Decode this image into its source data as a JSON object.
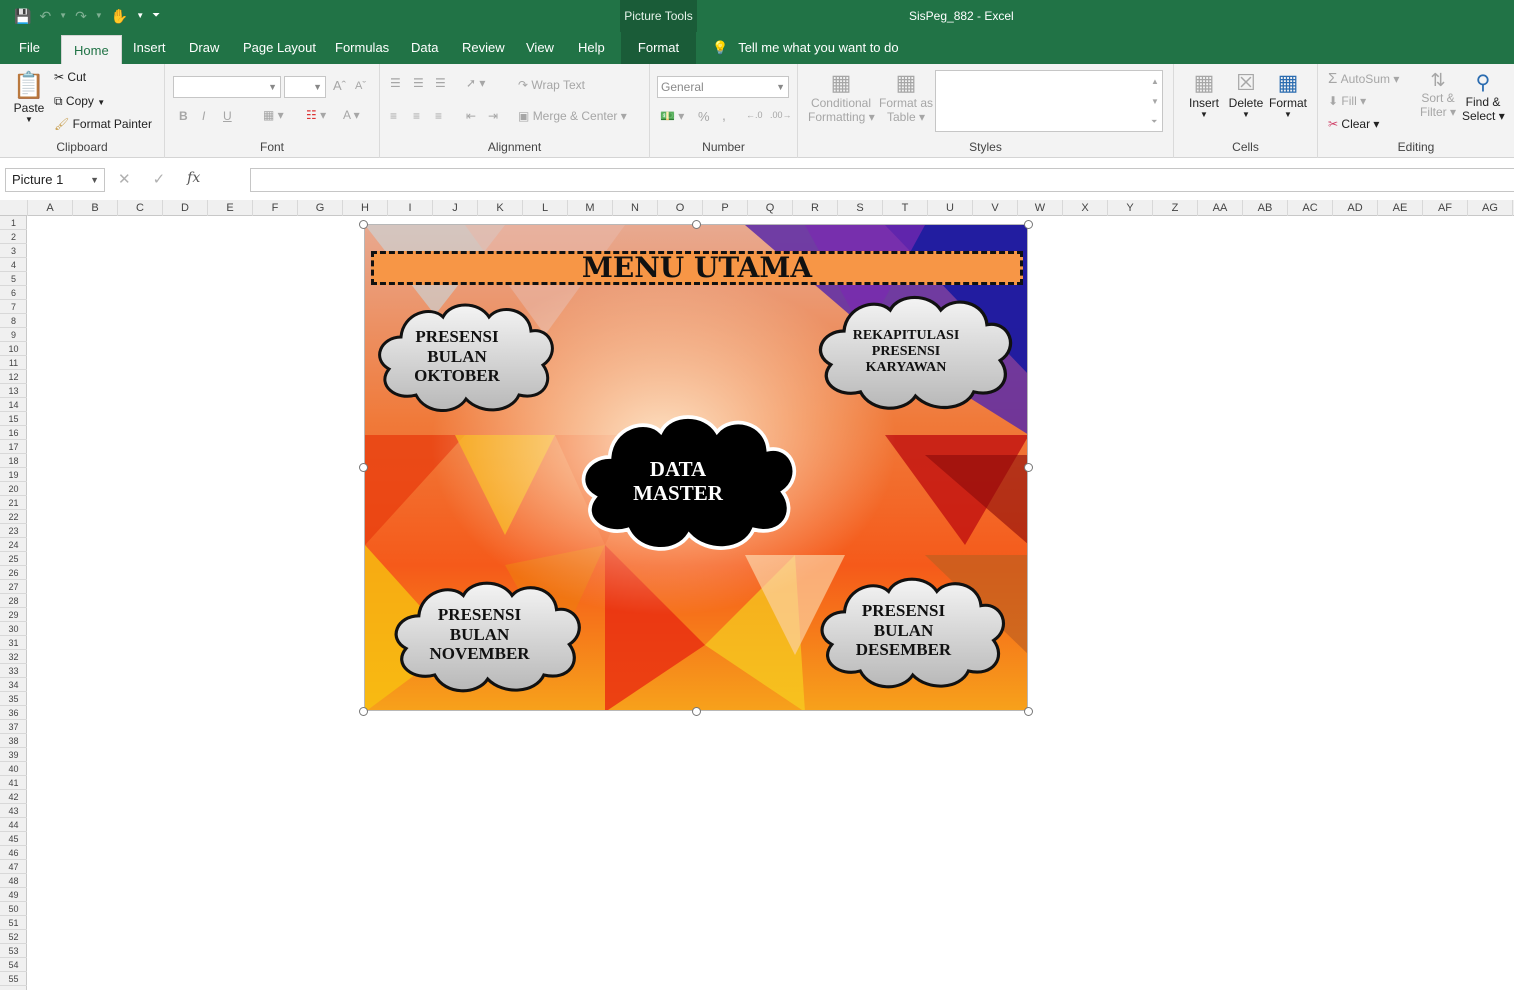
{
  "app": {
    "doc_title": "SisPeg_882  -  Excel",
    "context_tab_group": "Picture Tools"
  },
  "tabs": [
    {
      "label": "File"
    },
    {
      "label": "Home"
    },
    {
      "label": "Insert"
    },
    {
      "label": "Draw"
    },
    {
      "label": "Page Layout"
    },
    {
      "label": "Formulas"
    },
    {
      "label": "Data"
    },
    {
      "label": "Review"
    },
    {
      "label": "View"
    },
    {
      "label": "Help"
    },
    {
      "label": "Format"
    }
  ],
  "tell_me": "Tell me what you want to do",
  "ribbon": {
    "clipboard": {
      "label": "Clipboard",
      "paste": "Paste",
      "cut": "Cut",
      "copy": "Copy",
      "format_painter": "Format Painter"
    },
    "font": {
      "label": "Font",
      "bold": "B",
      "italic": "I",
      "underline": "U"
    },
    "alignment": {
      "label": "Alignment",
      "wrap": "Wrap Text",
      "merge": "Merge & Center"
    },
    "number": {
      "label": "Number",
      "format": "General",
      "percent": "%",
      "comma": ","
    },
    "styles": {
      "label": "Styles",
      "cond1": "Conditional",
      "cond2": "Formatting",
      "fmt1": "Format as",
      "fmt2": "Table"
    },
    "cells": {
      "label": "Cells",
      "insert": "Insert",
      "delete": "Delete",
      "format": "Format"
    },
    "editing": {
      "label": "Editing",
      "autosum": "AutoSum",
      "fill": "Fill",
      "clear": "Clear",
      "sort1": "Sort &",
      "sort2": "Filter",
      "find1": "Find &",
      "find2": "Select"
    }
  },
  "formula_bar": {
    "name_box": "Picture 1",
    "fx": "fx",
    "value": ""
  },
  "columns": [
    "A",
    "B",
    "C",
    "D",
    "E",
    "F",
    "G",
    "H",
    "I",
    "J",
    "K",
    "L",
    "M",
    "N",
    "O",
    "P",
    "Q",
    "R",
    "S",
    "T",
    "U",
    "V",
    "W",
    "X",
    "Y",
    "Z",
    "AA",
    "AB",
    "AC",
    "AD",
    "AE",
    "AF",
    "AG"
  ],
  "rows": [
    "1",
    "2",
    "3",
    "4",
    "5",
    "6",
    "7",
    "8",
    "9",
    "10",
    "11",
    "12",
    "13",
    "14",
    "15",
    "16",
    "17",
    "18",
    "19",
    "20",
    "21",
    "22",
    "23",
    "24",
    "25",
    "26",
    "27",
    "28",
    "29",
    "30",
    "31",
    "32",
    "33",
    "34",
    "35",
    "36",
    "37",
    "38",
    "39",
    "40",
    "41",
    "42",
    "43",
    "44",
    "45",
    "46",
    "47",
    "48",
    "49",
    "50",
    "51",
    "52",
    "53",
    "54",
    "55"
  ],
  "picture": {
    "title": "MENU UTAMA",
    "clouds": [
      {
        "lines": [
          "PRESENSI",
          "BULAN",
          "OKTOBER"
        ]
      },
      {
        "lines": [
          "REKAPITULASI",
          "PRESENSI",
          "KARYAWAN"
        ]
      },
      {
        "lines": [
          "DATA",
          "MASTER"
        ]
      },
      {
        "lines": [
          "PRESENSI",
          "BULAN",
          "NOVEMBER"
        ]
      },
      {
        "lines": [
          "PRESENSI",
          "BULAN",
          "DESEMBER"
        ]
      }
    ]
  },
  "colors": {
    "excel_green": "#217346",
    "title_orange": "#f79646"
  }
}
